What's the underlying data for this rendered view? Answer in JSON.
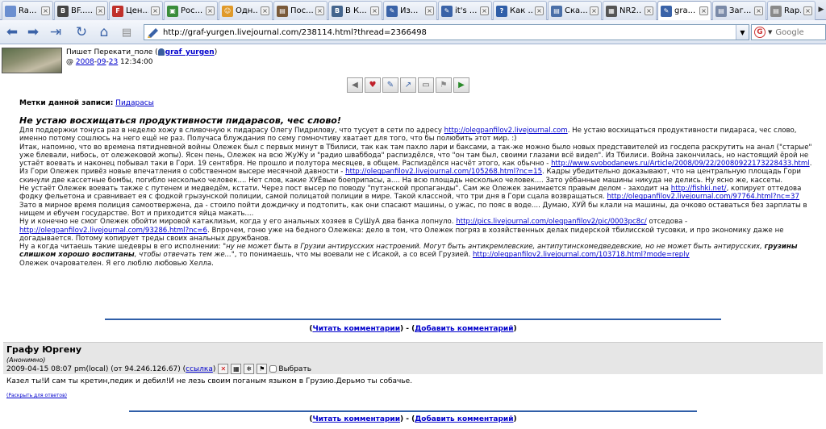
{
  "tabs": [
    {
      "label": "Ra...",
      "icon": "page-icon",
      "color": "#6b8fd0",
      "glyph": ""
    },
    {
      "label": "BF......",
      "icon": "bf-icon",
      "color": "#444444",
      "glyph": "B"
    },
    {
      "label": "Цен...",
      "icon": "news-icon",
      "color": "#c0302a",
      "glyph": "F"
    },
    {
      "label": "Рос...",
      "icon": "green-icon",
      "color": "#3a8d3a",
      "glyph": "▣"
    },
    {
      "label": "Одн...",
      "icon": "people-icon",
      "color": "#e09a2a",
      "glyph": "☺"
    },
    {
      "label": "Пос...",
      "icon": "doc-icon",
      "color": "#7a5a3a",
      "glyph": "▤"
    },
    {
      "label": "В К...",
      "icon": "vk-icon",
      "color": "#45668e",
      "glyph": "В"
    },
    {
      "label": "Из...",
      "icon": "lj-icon",
      "color": "#3a63a8",
      "glyph": "✎"
    },
    {
      "label": "it's ...",
      "icon": "lj-icon",
      "color": "#3a63a8",
      "glyph": "✎"
    },
    {
      "label": "Как ...",
      "icon": "question-icon",
      "color": "#2f5ea8",
      "glyph": "?"
    },
    {
      "label": "Ска...",
      "icon": "doc-icon",
      "color": "#4a6fa8",
      "glyph": "▤"
    },
    {
      "label": "NR2...",
      "icon": "nr-icon",
      "color": "#555555",
      "glyph": "▦"
    },
    {
      "label": "gra...",
      "icon": "lj-icon",
      "color": "#3a63a8",
      "glyph": "✎"
    },
    {
      "label": "Заг...",
      "icon": "doc-icon",
      "color": "#7a8aa8",
      "glyph": "▤"
    },
    {
      "label": "Rap...",
      "icon": "doc-icon",
      "color": "#8a8a8a",
      "glyph": "▤"
    }
  ],
  "nav": {
    "url": "http://graf-yurgen.livejournal.com/238114.html?thread=2366498",
    "search_placeholder": "Google"
  },
  "post": {
    "poster_prefix": "Пишет Перекати_поле (",
    "poster_user": "graf_yurgen",
    "poster_suffix": ")",
    "date_at": "@ ",
    "date_year": "2008",
    "date_month": "09",
    "date_day": "23",
    "date_time": " 12:34:00",
    "tags_label": "Метки данной записи:",
    "tag": "Пидарасы",
    "subject": "Не устаю восхищаться продуктивности пидарасов, чес слово!"
  },
  "body": {
    "p1_a": "Для поддержки тонуса раз в неделю хожу в сливочную к пидарасу Олегу Пидрилову, что тусует в сети по адресу ",
    "p1_link": "http://olegpanfilov2.livejournal.com",
    "p1_b": ". Не устаю восхищаться продуктивности пидараса, чес слово, именно потому сошлюсь на него ещё не раз. Получаса блуждания по сему гомночтиву хватает для того, что бы полюбить этот мир. :)",
    "p2_a": "Итак, напомню, что во времена пятидневной войны Олежек был с первых минут в Тбилиси, так как там пахло лари и баксами, а так-же можно было новых представителей из госдепа раскрутить на анал (\"старые\" уже блевали, нибось, от олежековой жопы). Ясен пень, Олежек на всю ЖуЖу и \"радио шваббода\" распиздёлся, что \"он там был, своими глазами всё видел\". Из Тбилиси. Война закончилась, но настоящий ёрой не устаёт воевать и наконец побывал таки в Гори. 19 сентября. Не прошло и полутора месяцев, в общем. Распиздёлся насчёт этого, как обычно - ",
    "p2_link": "http://www.svobodanews.ru/Article/2008/09/22/20080922173228433.html",
    "p2_b": ".",
    "p3_a": "Из Гори Олежек привёз новые впечатления о собственном высере месячной давности - ",
    "p3_link": "http://olegpanfilov2.livejournal.com/105268.html?nc=15",
    "p3_b": ". Кадры убедительно доказывают, что на центральную площадь Гори скинули две кассетные бомбы, погибло несколько человек.... Нет слов, какие ХУЁвые боеприпасы, а.... На всю площадь несколько человек.... Зато уёбанные машины никуда не делись. Ну ясно же, кассеты.",
    "p4_a": "Не устаёт Олежек воевать также с путенем и медведём, кстати. Через пост высер по поводу \"путэнской пропаганды\". Сам же Олежек занимается правым делом - заходит на ",
    "p4_link1": "http://fishki.net/",
    "p4_b": ", копирует оттедова фодку фельетона и сравнивает ея с фодкой грызунской полиции, самой полицатой полиции в мире. Такой классной, что три дня в Гори сцала возвращаться. ",
    "p4_link2": "http://olegpanfilov2.livejournal.com/97764.html?nc=37",
    "p4_c": " Зато в мирное время полиция самоотвержена, да - стоило пойти дождичку и подтопить, как они спасают машины, о ужас, по пояс в воде.... Думаю, ХУЙ бы клали на машины, да очково оставаться без зарплаты в нищем и ебучем государстве. Вот и приходится яйца макать....",
    "p5_a": "Ну и конечно не смог Олежек обойти мировой катаклизьм, когда у его анальных хозяев в СуШуА два банка лопнуло. ",
    "p5_link1": "http://pics.livejournal.com/olegpanfilov2/pic/0003pc8c/",
    "p5_b": " отседова - ",
    "p5_link2": "http://olegpanfilov2.livejournal.com/93286.html?nc=6",
    "p5_c": ". Впрочем, гоню уже на бедного Олежека: дело в том, что Олежек погряз в хозяйственных делах пидерской тбилисской тусовки, и про экономику даже не догадывается. Потому копирует треды своих анальных дружбанов.",
    "p6_a": "Ну а когда читаешь такие шедевры в его исполнении: ",
    "p6_quote1": "\"ну не может быть в Грузии антирусских настроений. Могут быть антикремлевские, антипутинскомедведевские, но не может быть антирусских, ",
    "p6_quote_bold": "грузины слишком хорошо воспитаны",
    "p6_quote2": ", чтобы отвечать тем же...\"",
    "p6_b": ", то понимаешь, что мы воевали не с Исакой, а со всей Грузией. ",
    "p6_link": "http://olegpanfilov2.livejournal.com/103718.html?mode=reply",
    "p7": "Олежек очарователен. Я его люблю любовью Хелла."
  },
  "comments_nav": {
    "open": "(",
    "read": "Читать комментарии",
    "sep": ") - (",
    "add": "Добавить комментарий",
    "close": ")"
  },
  "comment": {
    "subject": "Графу Юргену",
    "author": "(Анонимно)",
    "datetime": "2009-04-15 08:07 pm",
    "local": " (local) (от 94.246.126.67) (",
    "link_label": "ссылка",
    "link_close": ")",
    "select_label": "Выбрать",
    "text": "Казел ты!И сам ты кретин,педик и дебил!И не лезь своим поганым языком в Грузию.Дерьмо ты собачье.",
    "expand": "(Раскрыть для ответов)"
  }
}
